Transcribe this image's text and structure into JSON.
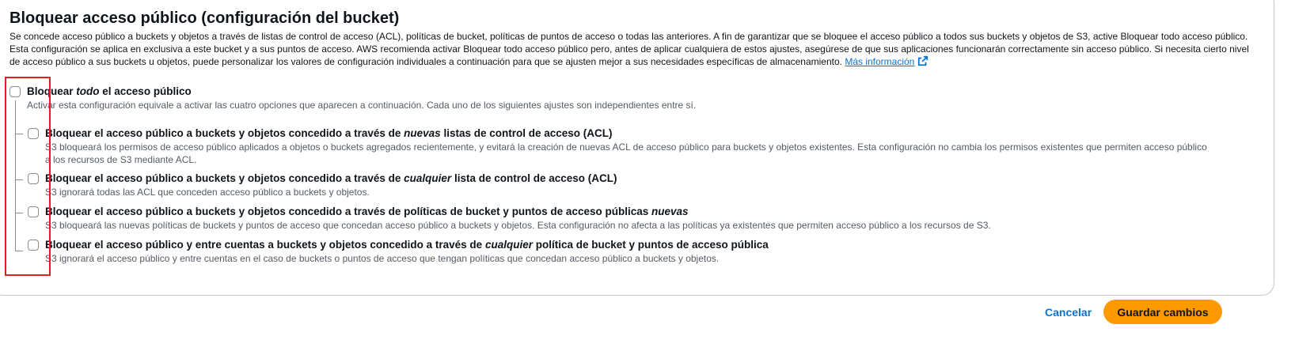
{
  "section": {
    "title": "Bloquear acceso público (configuración del bucket)",
    "description": "Se concede acceso público a buckets y objetos a través de listas de control de acceso (ACL), políticas de bucket, políticas de puntos de acceso o todas las anteriores. A fin de garantizar que se bloquee el acceso público a todos sus buckets y objetos de S3, active Bloquear todo acceso público. Esta configuración se aplica en exclusiva a este bucket y a sus puntos de acceso. AWS recomienda activar Bloquear todo acceso público pero, antes de aplicar cualquiera de estos ajustes, asegúrese de que sus aplicaciones funcionarán correctamente sin acceso público. Si necesita cierto nivel de acceso público a sus buckets u objetos, puede personalizar los valores de configuración individuales a continuación para que se ajusten mejor a sus necesidades específicas de almacenamiento.",
    "more_info_link": "Más información",
    "link_icon": "external-link-icon"
  },
  "options": {
    "block_all": {
      "label_pre": "Bloquear ",
      "label_em": "todo",
      "label_post": " el acceso público",
      "description": "Activar esta configuración equivale a activar las cuatro opciones que aparecen a continuación. Cada uno de los siguientes ajustes son independientes entre sí.",
      "checked": false
    },
    "sub": [
      {
        "label_pre": "Bloquear el acceso público a buckets y objetos concedido a través de ",
        "label_em": "nuevas",
        "label_post": " listas de control de acceso (ACL)",
        "description": "S3 bloqueará los permisos de acceso público aplicados a objetos o buckets agregados recientemente, y evitará la creación de nuevas ACL de acceso público para buckets y objetos existentes. Esta configuración no cambia los permisos existentes que permiten acceso público a los recursos de S3 mediante ACL.",
        "checked": false
      },
      {
        "label_pre": "Bloquear el acceso público a buckets y objetos concedido a través de ",
        "label_em": "cualquier",
        "label_post": " lista de control de acceso (ACL)",
        "description": "S3 ignorará todas las ACL que conceden acceso público a buckets y objetos.",
        "checked": false
      },
      {
        "label_pre": "Bloquear el acceso público a buckets y objetos concedido a través de políticas de bucket y puntos de acceso públicas ",
        "label_em": "nuevas",
        "label_post": "",
        "description": "S3 bloqueará las nuevas políticas de buckets y puntos de acceso que concedan acceso público a buckets y objetos. Esta configuración no afecta a las políticas ya existentes que permiten acceso público a los recursos de S3.",
        "checked": false
      },
      {
        "label_pre": "Bloquear el acceso público y entre cuentas a buckets y objetos concedido a través de ",
        "label_em": "cualquier",
        "label_post": " política de bucket y puntos de acceso pública",
        "description": "S3 ignorará el acceso público y entre cuentas en el caso de buckets o puntos de acceso que tengan políticas que concedan acceso público a buckets y objetos.",
        "checked": false
      }
    ]
  },
  "actions": {
    "cancel_label": "Cancelar",
    "save_label": "Guardar cambios"
  },
  "colors": {
    "accent": "#ff9900",
    "link": "#0972d3",
    "highlight_box": "#e02020"
  }
}
